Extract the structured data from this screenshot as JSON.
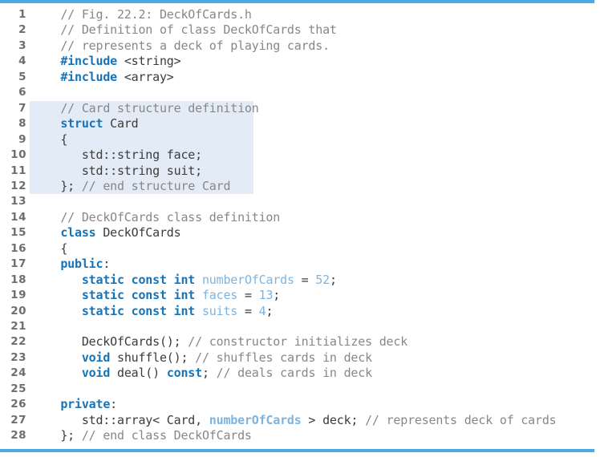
{
  "figure": {
    "caption_reference": "Fig. 22.2: DeckOfCards.h",
    "accent_color": "#4ba9e2",
    "highlight_color": "#e3ecf6",
    "comment_color": "#878787",
    "keyword_color": "#1673b8",
    "identifier_color": "#7cb4e0",
    "plain_color": "#3b3b3b",
    "lineno_color": "#6e6e6e",
    "background_color": "#ffffff",
    "total_lines": 28,
    "highlight_start_line": 7,
    "highlight_end_line": 12
  },
  "lines": [
    {
      "n": "1",
      "tokens": [
        {
          "t": "    ",
          "c": "plain"
        },
        {
          "t": "// Fig. 22.2: DeckOfCards.h",
          "c": "comment"
        }
      ]
    },
    {
      "n": "2",
      "tokens": [
        {
          "t": "    ",
          "c": "plain"
        },
        {
          "t": "// Definition of class DeckOfCards that",
          "c": "comment"
        }
      ]
    },
    {
      "n": "3",
      "tokens": [
        {
          "t": "    ",
          "c": "plain"
        },
        {
          "t": "// represents a deck of playing cards.",
          "c": "comment"
        }
      ]
    },
    {
      "n": "4",
      "tokens": [
        {
          "t": "    ",
          "c": "plain"
        },
        {
          "t": "#include",
          "c": "keyword"
        },
        {
          "t": " <string>",
          "c": "plain"
        }
      ]
    },
    {
      "n": "5",
      "tokens": [
        {
          "t": "    ",
          "c": "plain"
        },
        {
          "t": "#include",
          "c": "keyword"
        },
        {
          "t": " <array>",
          "c": "plain"
        }
      ]
    },
    {
      "n": "6",
      "tokens": []
    },
    {
      "n": "7",
      "tokens": [
        {
          "t": "    ",
          "c": "plain"
        },
        {
          "t": "// Card structure definition",
          "c": "comment"
        }
      ]
    },
    {
      "n": "8",
      "tokens": [
        {
          "t": "    ",
          "c": "plain"
        },
        {
          "t": "struct",
          "c": "keyword"
        },
        {
          "t": " Card",
          "c": "plain"
        }
      ]
    },
    {
      "n": "9",
      "tokens": [
        {
          "t": "    {",
          "c": "plain"
        }
      ]
    },
    {
      "n": "10",
      "tokens": [
        {
          "t": "       std::string face;",
          "c": "plain"
        }
      ]
    },
    {
      "n": "11",
      "tokens": [
        {
          "t": "       std::string suit;",
          "c": "plain"
        }
      ]
    },
    {
      "n": "12",
      "tokens": [
        {
          "t": "    }; ",
          "c": "plain"
        },
        {
          "t": "// end structure Card",
          "c": "comment"
        }
      ]
    },
    {
      "n": "13",
      "tokens": []
    },
    {
      "n": "14",
      "tokens": [
        {
          "t": "    ",
          "c": "plain"
        },
        {
          "t": "// DeckOfCards class definition",
          "c": "comment"
        }
      ]
    },
    {
      "n": "15",
      "tokens": [
        {
          "t": "    ",
          "c": "plain"
        },
        {
          "t": "class",
          "c": "keyword"
        },
        {
          "t": " DeckOfCards",
          "c": "plain"
        }
      ]
    },
    {
      "n": "16",
      "tokens": [
        {
          "t": "    {",
          "c": "plain"
        }
      ]
    },
    {
      "n": "17",
      "tokens": [
        {
          "t": "    ",
          "c": "plain"
        },
        {
          "t": "public",
          "c": "keyword"
        },
        {
          "t": ":",
          "c": "plain"
        }
      ]
    },
    {
      "n": "18",
      "tokens": [
        {
          "t": "       ",
          "c": "plain"
        },
        {
          "t": "static const int",
          "c": "keyword"
        },
        {
          "t": " ",
          "c": "plain"
        },
        {
          "t": "numberOfCards",
          "c": "ident"
        },
        {
          "t": " = ",
          "c": "plain"
        },
        {
          "t": "52",
          "c": "num"
        },
        {
          "t": ";",
          "c": "plain"
        }
      ]
    },
    {
      "n": "19",
      "tokens": [
        {
          "t": "       ",
          "c": "plain"
        },
        {
          "t": "static const int",
          "c": "keyword"
        },
        {
          "t": " ",
          "c": "plain"
        },
        {
          "t": "faces",
          "c": "ident"
        },
        {
          "t": " = ",
          "c": "plain"
        },
        {
          "t": "13",
          "c": "num"
        },
        {
          "t": ";",
          "c": "plain"
        }
      ]
    },
    {
      "n": "20",
      "tokens": [
        {
          "t": "       ",
          "c": "plain"
        },
        {
          "t": "static const int",
          "c": "keyword"
        },
        {
          "t": " ",
          "c": "plain"
        },
        {
          "t": "suits",
          "c": "ident"
        },
        {
          "t": " = ",
          "c": "plain"
        },
        {
          "t": "4",
          "c": "num"
        },
        {
          "t": ";",
          "c": "plain"
        }
      ]
    },
    {
      "n": "21",
      "tokens": []
    },
    {
      "n": "22",
      "tokens": [
        {
          "t": "       DeckOfCards(); ",
          "c": "plain"
        },
        {
          "t": "// constructor initializes deck",
          "c": "comment"
        }
      ]
    },
    {
      "n": "23",
      "tokens": [
        {
          "t": "       ",
          "c": "plain"
        },
        {
          "t": "void",
          "c": "keyword"
        },
        {
          "t": " shuffle(); ",
          "c": "plain"
        },
        {
          "t": "// shuffles cards in deck",
          "c": "comment"
        }
      ]
    },
    {
      "n": "24",
      "tokens": [
        {
          "t": "       ",
          "c": "plain"
        },
        {
          "t": "void",
          "c": "keyword"
        },
        {
          "t": " deal() ",
          "c": "plain"
        },
        {
          "t": "const",
          "c": "keyword"
        },
        {
          "t": "; ",
          "c": "plain"
        },
        {
          "t": "// deals cards in deck",
          "c": "comment"
        }
      ]
    },
    {
      "n": "25",
      "tokens": []
    },
    {
      "n": "26",
      "tokens": [
        {
          "t": "    ",
          "c": "plain"
        },
        {
          "t": "private",
          "c": "keyword"
        },
        {
          "t": ":",
          "c": "plain"
        }
      ]
    },
    {
      "n": "27",
      "tokens": [
        {
          "t": "       std::array< Card, ",
          "c": "plain"
        },
        {
          "t": "numberOfCards",
          "c": "identb"
        },
        {
          "t": " > deck; ",
          "c": "plain"
        },
        {
          "t": "// represents deck of cards",
          "c": "comment"
        }
      ]
    },
    {
      "n": "28",
      "tokens": [
        {
          "t": "    }; ",
          "c": "plain"
        },
        {
          "t": "// end class DeckOfCards",
          "c": "comment"
        }
      ]
    }
  ]
}
